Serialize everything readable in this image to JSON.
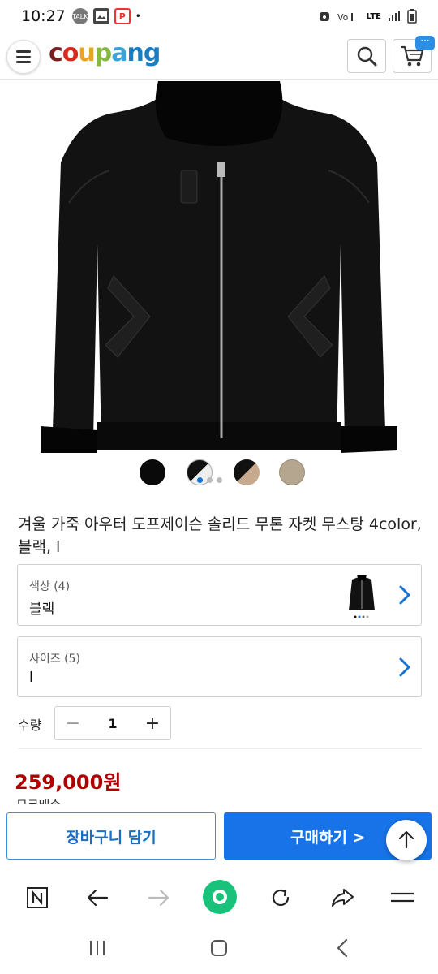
{
  "status_bar": {
    "time": "10:27",
    "notif_icons": [
      "talk-icon",
      "gallery-icon",
      "p-app-icon"
    ],
    "network": "LTE",
    "more_dot": "•"
  },
  "header": {
    "logo_parts": [
      "c",
      "o",
      "u",
      "p",
      "a",
      "ng"
    ],
    "cart_badge": "···"
  },
  "product": {
    "title": "겨울 가죽 아우터 도프제이슨 솔리드 무톤 자켓 무스탕 4color, 블랙, l",
    "swatches": [
      {
        "name": "black"
      },
      {
        "name": "black-white-selected"
      },
      {
        "name": "black-beige"
      },
      {
        "name": "beige"
      }
    ],
    "image_page_count": 3,
    "active_page": 0
  },
  "options": {
    "color": {
      "label": "색상 (4)",
      "value": "블랙"
    },
    "size": {
      "label": "사이즈 (5)",
      "value": "l"
    }
  },
  "quantity": {
    "label": "수량",
    "value": "1",
    "minus": "−",
    "plus": "+"
  },
  "price": {
    "value": "259,000원",
    "cut_text": "무료배송"
  },
  "actions": {
    "cart_label": "장바구니 담기",
    "buy_label": "구매하기 >"
  },
  "colors": {
    "accent": "#1873e8",
    "price": "#ae0000",
    "browser_home": "#19c27a"
  }
}
